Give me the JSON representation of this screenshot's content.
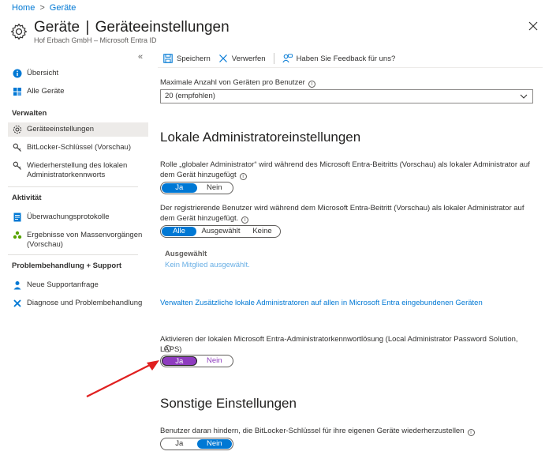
{
  "breadcrumb": {
    "home": "Home",
    "current": "Geräte"
  },
  "header": {
    "title_main": "Geräte",
    "title_sep": "|",
    "title_sub": "Geräteeinstellungen",
    "ellipsis": "···",
    "subtitle": "Hof Erbach GmbH – Microsoft Entra ID"
  },
  "sidebar": {
    "collapse": "«",
    "top_items": [
      {
        "label": "Übersicht",
        "icon": "info-icon"
      },
      {
        "label": "Alle Geräte",
        "icon": "grid-icon"
      }
    ],
    "groups": [
      {
        "heading": "Verwalten",
        "items": [
          {
            "label": "Geräteeinstellungen",
            "icon": "gear-icon",
            "active": true
          },
          {
            "label": "BitLocker-Schlüssel (Vorschau)",
            "icon": "key-icon"
          },
          {
            "label": "Wiederherstellung des lokalen Administratorkennworts",
            "icon": "key-icon"
          }
        ]
      },
      {
        "heading": "Aktivität",
        "items": [
          {
            "label": "Überwachungsprotokolle",
            "icon": "log-icon"
          },
          {
            "label": "Ergebnisse von Massenvorgängen (Vorschau)",
            "icon": "people-icon"
          }
        ]
      },
      {
        "heading": "Problembehandlung + Support",
        "items": [
          {
            "label": "Neue Supportanfrage",
            "icon": "person-support-icon"
          },
          {
            "label": "Diagnose und Problembehandlung",
            "icon": "wrench-icon"
          }
        ]
      }
    ]
  },
  "toolbar": {
    "save": "Speichern",
    "discard": "Verwerfen",
    "feedback": "Haben Sie Feedback für uns?"
  },
  "main": {
    "max_devices_label": "Maximale Anzahl von Geräten pro Benutzer",
    "max_devices_value": "20 (empfohlen)",
    "local_admin_title": "Lokale Administratoreinstellungen",
    "global_admin_label": "Rolle „globaler Administrator“ wird während des Microsoft Entra-Beitritts (Vorschau) als lokaler Administrator auf dem Gerät hinzugefügt",
    "global_admin_toggle": {
      "options": [
        "Ja",
        "Nein"
      ],
      "selected": "Ja"
    },
    "registering_user_label": "Der registrierende Benutzer wird während dem Microsoft Entra-Beitritt (Vorschau) als lokaler Administrator auf dem Gerät hinzugefügt.",
    "registering_user_toggle": {
      "options": [
        "Alle",
        "Ausgewählt",
        "Keine"
      ],
      "selected": "Alle"
    },
    "selected_heading": "Ausgewählt",
    "selected_none": "Kein Mitglied ausgewählt.",
    "manage_link": "Verwalten Zusätzliche lokale Administratoren auf allen in Microsoft Entra eingebundenen Geräten",
    "laps_label": "Aktivieren der lokalen Microsoft Entra-Administratorkennwortlösung (Local Administrator Password Solution, LAPS)",
    "laps_toggle": {
      "options": [
        "Ja",
        "Nein"
      ],
      "selected": "Ja"
    },
    "other_title": "Sonstige Einstellungen",
    "bitlocker_label": "Benutzer daran hindern, die BitLocker-Schlüssel für ihre eigenen Geräte wiederherzustellen",
    "bitlocker_toggle": {
      "options": [
        "Ja",
        "Nein"
      ],
      "selected": "Nein"
    }
  },
  "colors": {
    "accent": "#0078d4",
    "highlight": "#8e3cbf",
    "annotation_arrow": "#e02020"
  }
}
